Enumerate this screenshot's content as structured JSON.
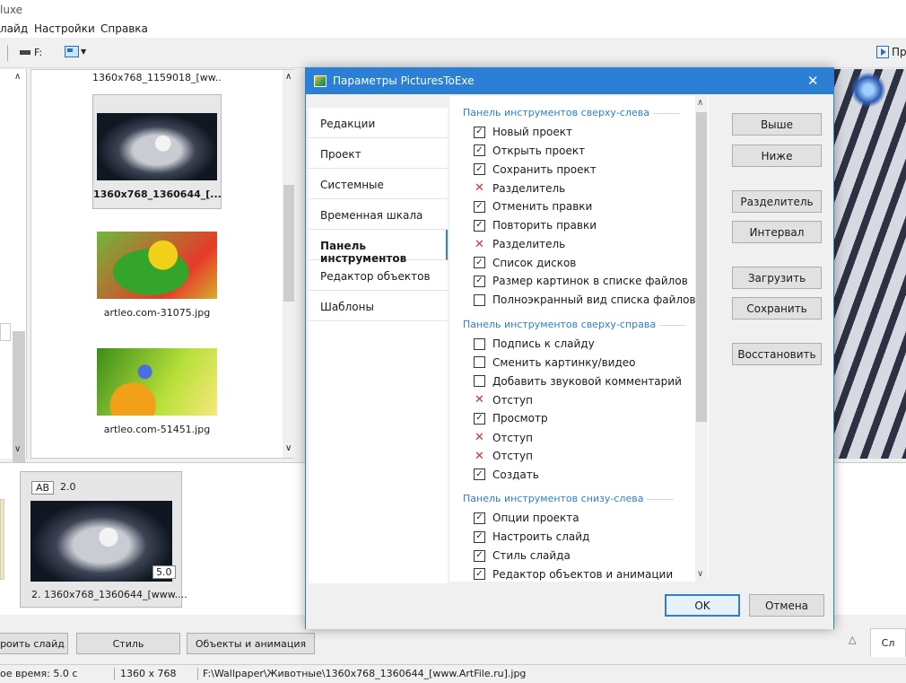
{
  "app": {
    "title_fragment": "luxe"
  },
  "menu": [
    "лайд",
    "Настройки",
    "Справка"
  ],
  "toolbar": {
    "drive_label": "F:",
    "preview_label": "Пр"
  },
  "file_list": {
    "items": [
      {
        "caption": "1360x768_1159018_[ww...",
        "selected": false
      },
      {
        "caption": "1360x768_1360644_[...",
        "selected": true
      },
      {
        "caption": "artleo.com-31075.jpg",
        "selected": false
      },
      {
        "caption": "artleo.com-51451.jpg",
        "selected": false
      }
    ]
  },
  "timeline": {
    "slide": {
      "transition_badge": "AB",
      "transition_duration": "2.0",
      "duration": "5.0",
      "caption": "2. 1360x768_1360644_[www...."
    }
  },
  "bottom_bar": {
    "buttons": [
      "роить слайд",
      "Стиль",
      "Объекты и анимация"
    ],
    "tab_label": "Сл"
  },
  "status": {
    "time": "ое время: 5.0 с",
    "resolution": "1360 x 768",
    "path": "F:\\Wallpaper\\Животные\\1360x768_1360644_[www.ArtFile.ru].jpg"
  },
  "dialog": {
    "title": "Параметры PicturesToExe",
    "nav": [
      {
        "label": "Редакции",
        "active": false
      },
      {
        "label": "Проект",
        "active": false
      },
      {
        "label": "Системные",
        "active": false
      },
      {
        "label": "Временная шкала",
        "active": false
      },
      {
        "label": "Панель инструментов",
        "active": true
      },
      {
        "label": "Редактор объектов",
        "active": false
      },
      {
        "label": "Шаблоны",
        "active": false
      }
    ],
    "groups": [
      {
        "title": "Панель инструментов сверху-слева",
        "items": [
          {
            "label": "Новый проект",
            "state": "checked"
          },
          {
            "label": "Открыть проект",
            "state": "checked"
          },
          {
            "label": "Сохранить проект",
            "state": "checked"
          },
          {
            "label": "Разделитель",
            "state": "x"
          },
          {
            "label": "Отменить правки",
            "state": "checked"
          },
          {
            "label": "Повторить правки",
            "state": "checked"
          },
          {
            "label": "Разделитель",
            "state": "x"
          },
          {
            "label": "Список дисков",
            "state": "checked"
          },
          {
            "label": "Размер картинок в списке файлов",
            "state": "checked"
          },
          {
            "label": "Полноэкранный вид списка файлов",
            "state": "unchecked"
          }
        ]
      },
      {
        "title": "Панель инструментов сверху-справа",
        "items": [
          {
            "label": "Подпись к слайду",
            "state": "unchecked"
          },
          {
            "label": "Сменить картинку/видео",
            "state": "unchecked"
          },
          {
            "label": "Добавить звуковой комментарий",
            "state": "unchecked"
          },
          {
            "label": "Отступ",
            "state": "x"
          },
          {
            "label": "Просмотр",
            "state": "checked"
          },
          {
            "label": "Отступ",
            "state": "x"
          },
          {
            "label": "Отступ",
            "state": "x"
          },
          {
            "label": "Создать",
            "state": "checked"
          }
        ]
      },
      {
        "title": "Панель инструментов снизу-слева",
        "items": [
          {
            "label": "Опции проекта",
            "state": "checked"
          },
          {
            "label": "Настроить слайд",
            "state": "checked"
          },
          {
            "label": "Стиль слайда",
            "state": "checked"
          },
          {
            "label": "Редактор объектов и анимации",
            "state": "checked"
          }
        ]
      }
    ],
    "side_buttons": [
      "Выше",
      "Ниже",
      "Разделитель",
      "Интервал",
      "Загрузить",
      "Сохранить",
      "Восстановить"
    ],
    "ok_label": "OK",
    "cancel_label": "Отмена"
  }
}
